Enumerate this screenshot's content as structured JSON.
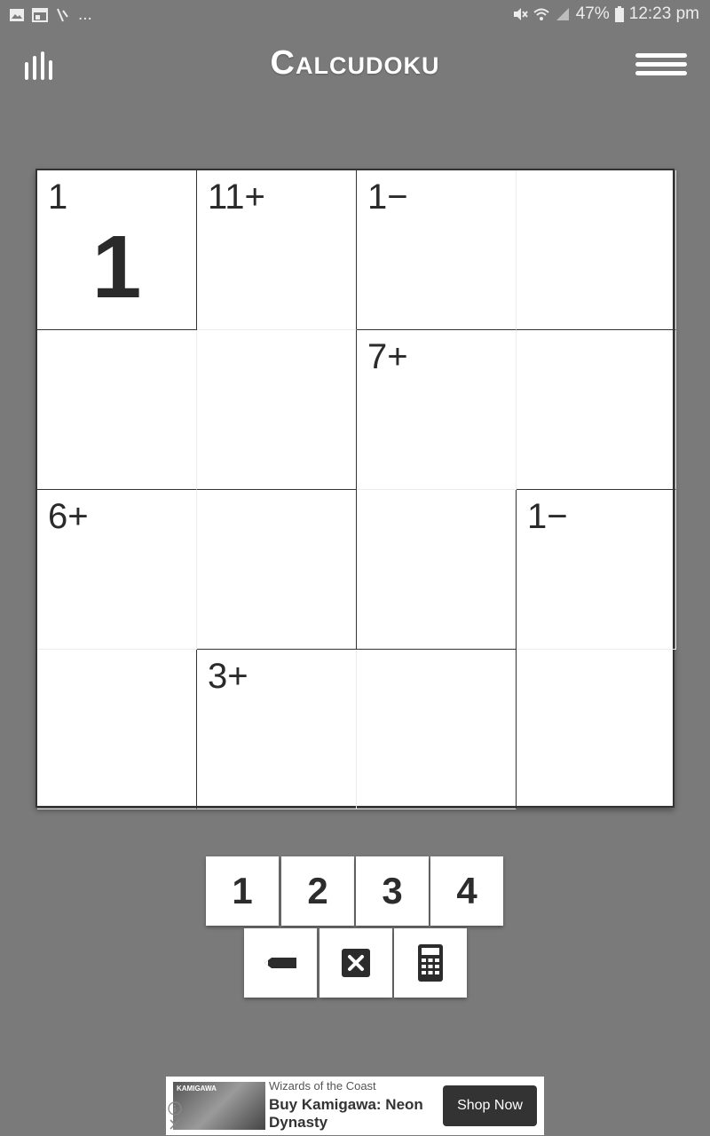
{
  "status_bar": {
    "left_overflow": "...",
    "battery_percent": "47%",
    "time": "12:23 pm"
  },
  "header": {
    "title": "Calcudoku",
    "stats_icon": "stats-bars-icon",
    "menu_icon": "hamburger-menu-icon"
  },
  "board": {
    "size": 4,
    "cells": [
      {
        "cage": "1",
        "value": "1"
      },
      {
        "cage": "11+",
        "value": ""
      },
      {
        "cage": "1−",
        "value": ""
      },
      {
        "cage": "",
        "value": ""
      },
      {
        "cage": "",
        "value": ""
      },
      {
        "cage": "",
        "value": ""
      },
      {
        "cage": "7+",
        "value": ""
      },
      {
        "cage": "",
        "value": ""
      },
      {
        "cage": "6+",
        "value": ""
      },
      {
        "cage": "",
        "value": ""
      },
      {
        "cage": "",
        "value": ""
      },
      {
        "cage": "1−",
        "value": ""
      },
      {
        "cage": "",
        "value": ""
      },
      {
        "cage": "3+",
        "value": ""
      },
      {
        "cage": "",
        "value": ""
      },
      {
        "cage": "",
        "value": ""
      }
    ]
  },
  "keypad": {
    "digits": [
      "1",
      "2",
      "3",
      "4"
    ],
    "tools": [
      "pencil-icon",
      "clear-icon",
      "calculator-icon"
    ]
  },
  "ad": {
    "thumb_text": "KAMIGAWA",
    "sponsor": "Wizards of the Coast",
    "headline": "Buy Kamigawa: Neon Dynasty",
    "cta": "Shop Now"
  },
  "colors": {
    "background": "#7a7a7a",
    "board": "#ffffff",
    "text_dark": "#2a2a2a"
  }
}
